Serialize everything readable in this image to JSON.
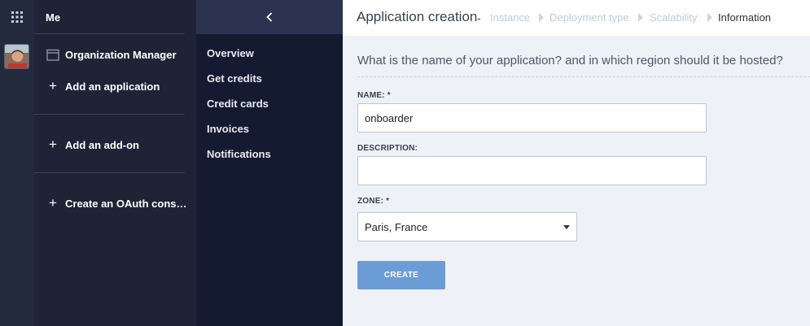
{
  "rail": {
    "apps_icon": "grid-icon",
    "avatar": "user-avatar"
  },
  "org": {
    "me_label": "Me",
    "items": [
      {
        "icon": "calendar-icon",
        "label": "Organization Manager"
      },
      {
        "icon": "plus-icon",
        "label": "Add an application"
      },
      {
        "icon": "plus-icon",
        "label": "Add an add-on"
      },
      {
        "icon": "plus-icon",
        "label": "Create an OAuth cons…"
      }
    ]
  },
  "submenu": {
    "collapse_icon": "chevron-left-icon",
    "items": [
      "Overview",
      "Get credits",
      "Credit cards",
      "Invoices",
      "Notifications"
    ]
  },
  "header": {
    "title": "Application creation",
    "separator": "-",
    "breadcrumb": [
      "Instance",
      "Deployment type",
      "Scalability",
      "Information"
    ]
  },
  "form": {
    "question": "What is the name of your application? and in which region should it be hosted?",
    "name_label": "NAME: *",
    "name_value": "onboarder",
    "description_label": "DESCRIPTION:",
    "description_value": "",
    "zone_label": "ZONE: *",
    "zone_value": "Paris, France",
    "create_label": "CREATE"
  },
  "colors": {
    "accent": "#6c9cd5",
    "rail": "#232a3e",
    "org_panel": "#1e2436",
    "submenu": "#141a30"
  }
}
